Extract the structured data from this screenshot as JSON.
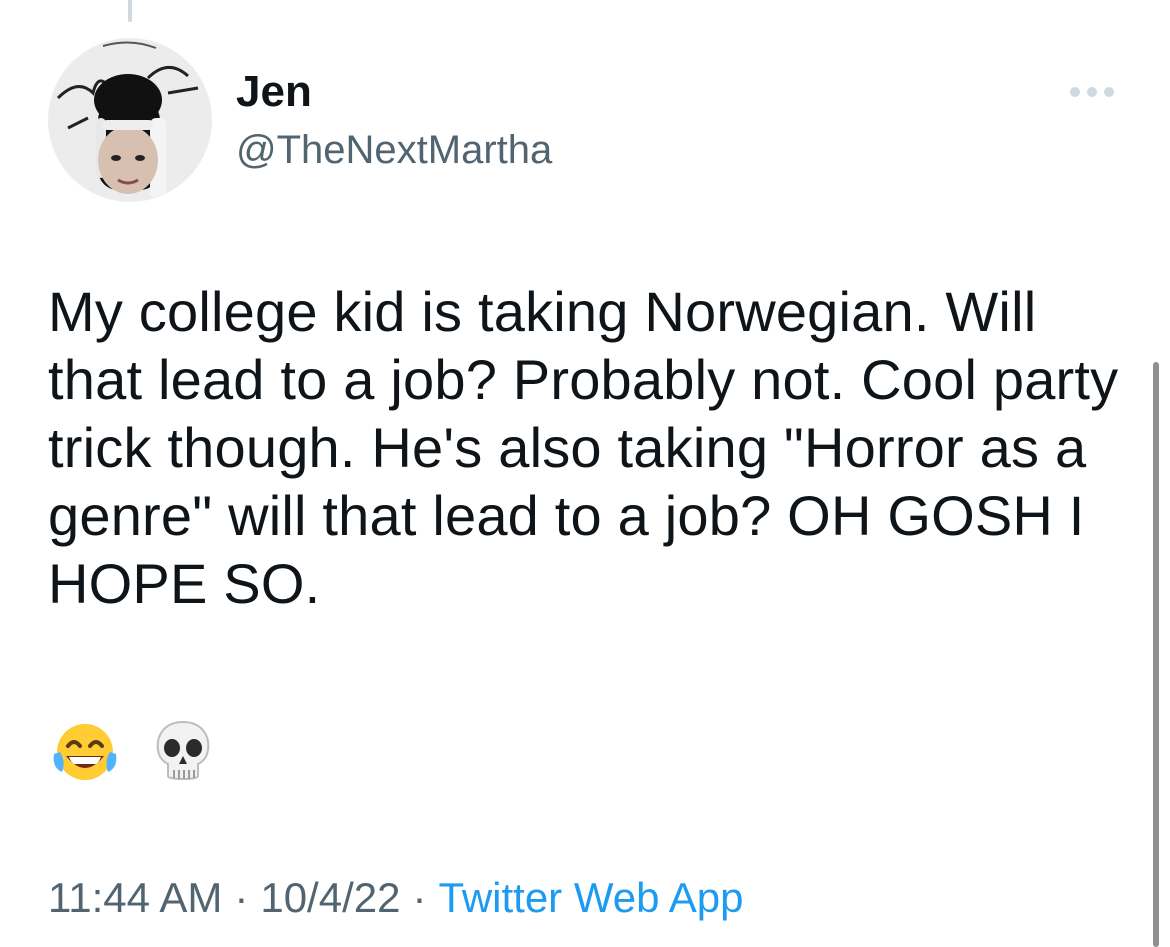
{
  "tweet": {
    "author": {
      "display_name": "Jen",
      "handle": "@TheNextMartha",
      "avatar_icon": "profile-avatar"
    },
    "more_icon": "more-horizontal-icon",
    "text": "My college kid is taking Norwegian. Will that lead to a job? Probably not. Cool party trick though. He's also taking \"Horror as a genre\" will that lead to a job? OH GOSH I HOPE SO.",
    "emojis": [
      "face-with-tears-of-joy",
      "skull"
    ],
    "time": "11:44 AM",
    "separator": "·",
    "date": "10/4/22",
    "source": "Twitter Web App"
  },
  "colors": {
    "text_primary": "#0f1419",
    "text_secondary": "#536471",
    "link": "#1d9bf0"
  }
}
